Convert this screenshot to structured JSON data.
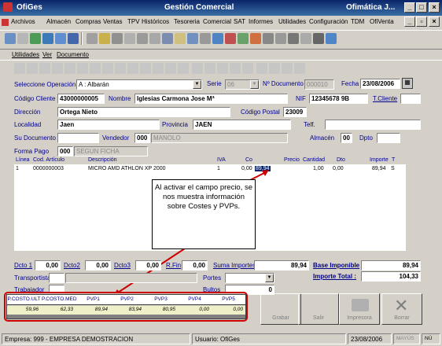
{
  "window": {
    "app_name": "OfiGes",
    "title": "Gestión Comercial",
    "vendor": "Ofimática J..."
  },
  "menu": [
    "Archivos",
    "Almacén",
    "Compras",
    "Ventas",
    "TPV",
    "Históricos",
    "Tesoreria",
    "Comercial",
    "SAT",
    "Informes",
    "Utilidades",
    "Configuración",
    "TDM",
    "OfiVenta"
  ],
  "submenu": [
    "Utilidades",
    "Ver",
    "Documento"
  ],
  "form": {
    "operation_label": "Seleccione Operación",
    "operation_value": "A : Albarán",
    "serie_label": "Serie",
    "serie_value": "06",
    "doc_label": "Nº Documento",
    "doc_value": "000010",
    "date_label": "Fecha",
    "date_value": "23/08/2006",
    "client_code_label": "Código Cliente",
    "client_code_value": "43000000005",
    "name_label": "Nombre",
    "name_value": "Iglesias Carmona Jose Mª",
    "nif_label": "NIF",
    "nif_value": "12345678 9B",
    "tcliente_label": "T.Cliente",
    "address_label": "Dirección",
    "address_value": "Ortega Nieto",
    "postal_label": "Código Postal",
    "postal_value": "23009",
    "city_label": "Localidad",
    "city_value": "Jaen",
    "province_label": "Provincia",
    "province_value": "JAEN",
    "phone_label": "Telf.",
    "your_doc_label": "Su Documento",
    "seller_label": "Vendedor",
    "seller_code": "000",
    "seller_name": "MANOLO",
    "warehouse_label": "Almacén",
    "warehouse_value": "00",
    "dpto_label": "Dpto",
    "payment_label": "Forma Pago",
    "payment_code": "000",
    "payment_name": "SEGUN FICHA"
  },
  "grid": {
    "headers": [
      "Línea",
      "Cod. Artículo",
      "Descripción",
      "IVA",
      "Co",
      "Precio",
      "Cantidad",
      "Dto",
      "Importe",
      "T"
    ],
    "row": [
      "1",
      "0000000003",
      "MICRO AMD ATHLON XP 2000",
      "1",
      "0,00",
      "89,94",
      "1,00",
      "0,00",
      "89,94",
      "S"
    ]
  },
  "callout": "Al activar el campo precio, se nos muestra información sobre Costes y PVPs.",
  "totals": {
    "dcto1_label": "Dcto 1",
    "dcto1": "0,00",
    "dcto2_label": "Dcto2",
    "dcto2": "0,00",
    "dcto3_label": "Dcto3",
    "dcto3": "0,00",
    "rfin_label": "R.Fin",
    "rfin": "0,00",
    "suma_label": "Suma Importes",
    "suma": "89,94",
    "base_label": "Base Imponible",
    "base": "89,94",
    "total_label": "Importe Total :",
    "total": "104,33",
    "transport_label": "Transportista",
    "portes_label": "Portes",
    "worker_label": "Trabajador",
    "bultos_label": "Bultos",
    "bultos": "0"
  },
  "costs": {
    "headers": [
      "P.COSTO.ULT",
      "P.COSTO.MED",
      "PVP1",
      "PVP2",
      "PVP3",
      "PVP4",
      "PVP5"
    ],
    "values": [
      "59,96",
      "62,33",
      "89,94",
      "83,94",
      "80,95",
      "0,00",
      "0,00"
    ]
  },
  "buttons": [
    "Grabar",
    "Salir",
    "Impresora",
    "Borrar"
  ],
  "status": {
    "company": "Empresa: 999 - EMPRESA DEMOSTRACION",
    "user": "Usuario: OfiGes",
    "date": "23/08/2006",
    "mayus": "MAYÚS",
    "num": "NÚ"
  }
}
